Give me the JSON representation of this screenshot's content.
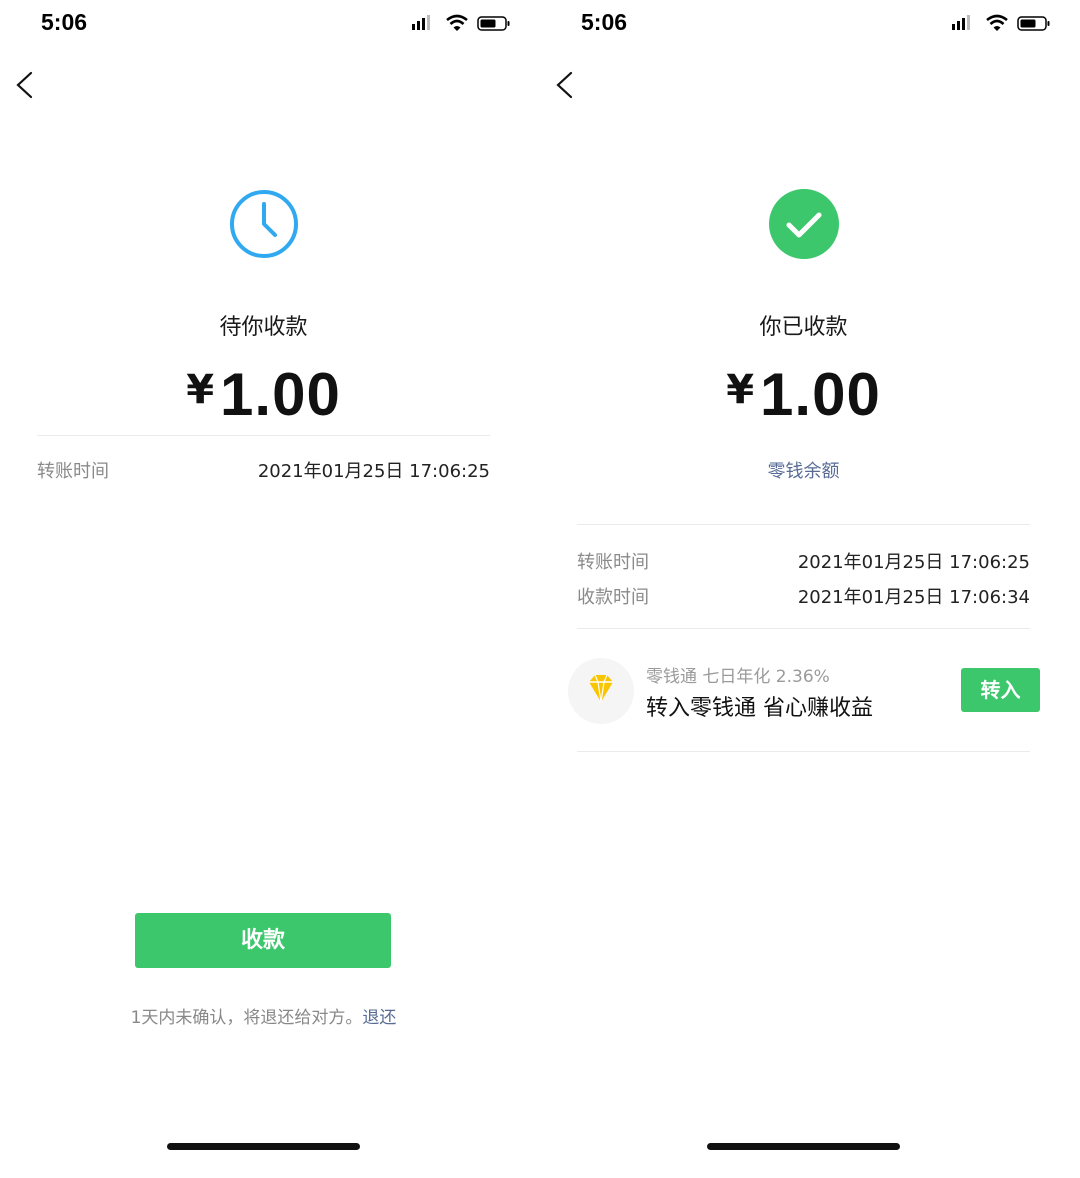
{
  "left": {
    "status_bar": {
      "time": "5:06"
    },
    "status_icon": "clock-icon",
    "status_text": "待你收款",
    "amount": {
      "currency": "¥",
      "value": "1.00"
    },
    "rows": [
      {
        "label": "转账时间",
        "value": "2021年01月25日 17:06:25"
      }
    ],
    "action_button": "收款",
    "note": {
      "text": "1天内未确认，将退还给对方。",
      "link": "退还"
    }
  },
  "right": {
    "status_bar": {
      "time": "5:06"
    },
    "status_icon": "check-circle-icon",
    "status_text": "你已收款",
    "amount": {
      "currency": "¥",
      "value": "1.00"
    },
    "balance_link": "零钱余额",
    "rows": [
      {
        "label": "转账时间",
        "value": "2021年01月25日 17:06:25"
      },
      {
        "label": "收款时间",
        "value": "2021年01月25日 17:06:34"
      }
    ],
    "fund_card": {
      "icon": "diamond-icon",
      "subtitle": "零钱通 七日年化 2.36%",
      "title": "转入零钱通 省心赚收益",
      "button": "转入"
    }
  },
  "colors": {
    "primary_green": "#3cc76c",
    "pending_blue": "#30a9f0",
    "link_blue": "#576b95"
  }
}
